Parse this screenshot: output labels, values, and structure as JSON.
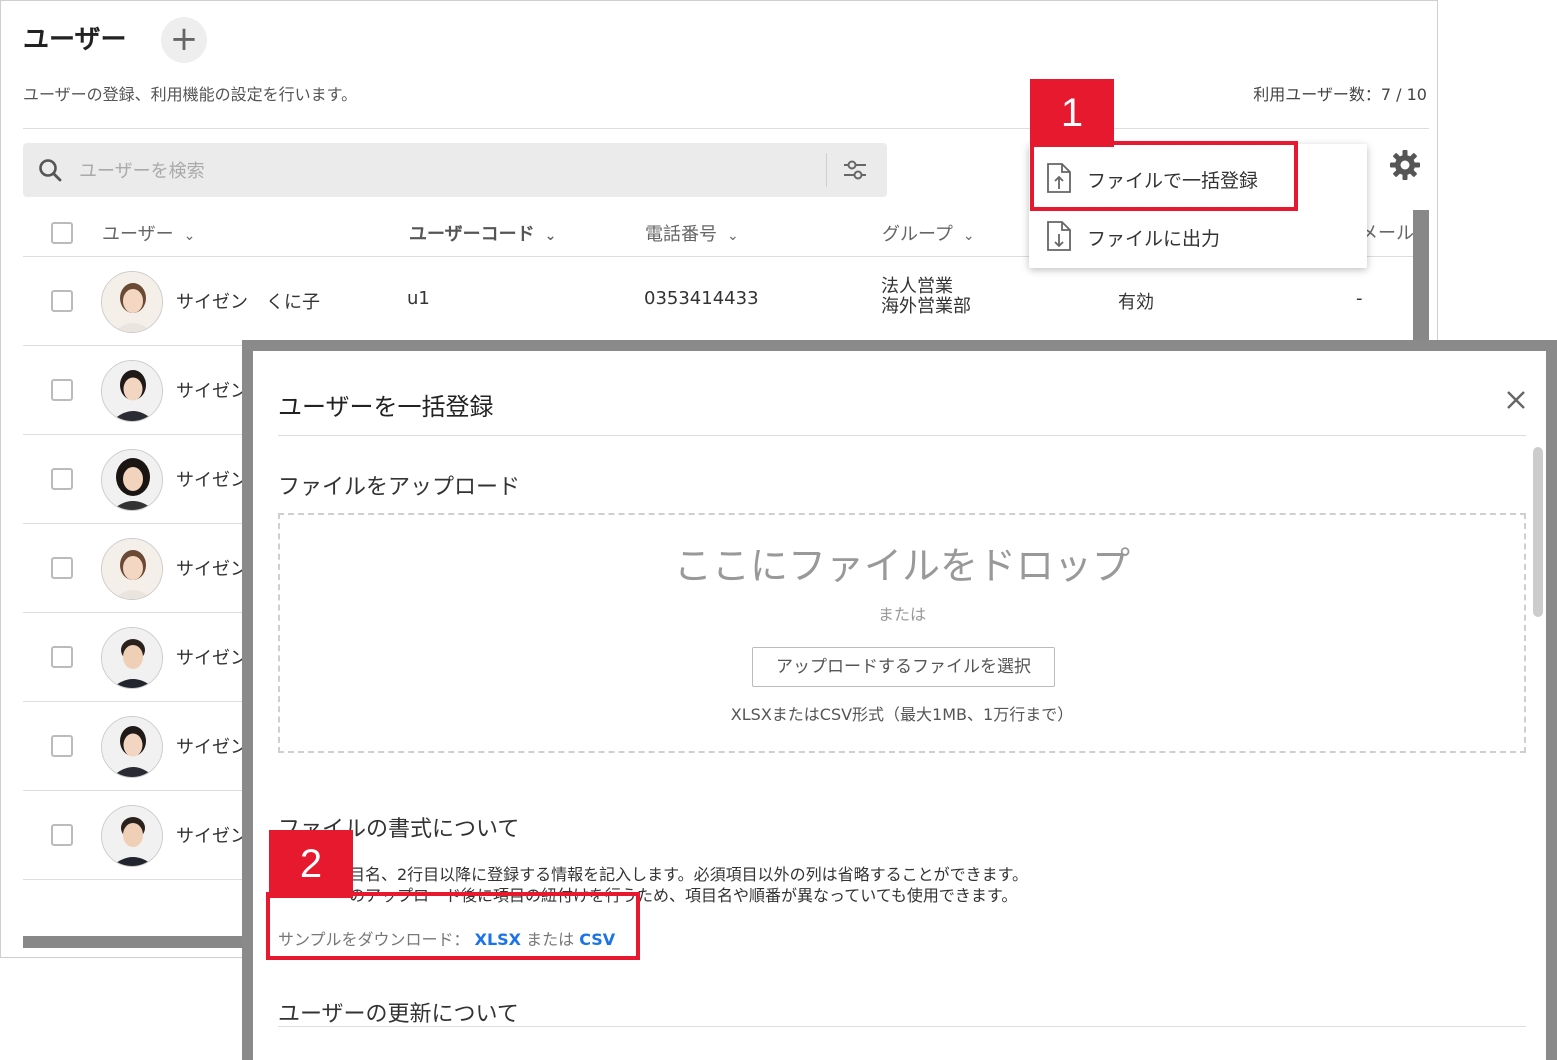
{
  "page": {
    "title": "ユーザー",
    "add_symbol": "+",
    "description": "ユーザーの登録、利用機能の設定を行います。",
    "user_count": "利用ユーザー数：7 / 10"
  },
  "search": {
    "placeholder": "ユーザーを検索"
  },
  "table": {
    "columns": [
      "ユーザー",
      "ユーザーコード",
      "電話番号",
      "グループ"
    ],
    "mail_column_partial": "メール",
    "first_row": {
      "name": "サイゼン　くに子",
      "code": "u1",
      "phone": "0353414433",
      "group_line1": "法人営業",
      "group_line2": "海外営業部",
      "status": "有効",
      "mail": "-"
    },
    "other_rows": [
      "サイゼン",
      "サイゼン",
      "サイゼン",
      "サイゼン",
      "サイゼン",
      "サイゼン"
    ]
  },
  "menu": {
    "items": [
      "ファイルで一括登録",
      "ファイルに出力"
    ]
  },
  "annotations": {
    "step1": "1",
    "step2": "2"
  },
  "modal": {
    "title": "ユーザーを一括登録",
    "upload_heading": "ファイルをアップロード",
    "drop_title": "ここにファイルをドロップ",
    "drop_or": "または",
    "select_button": "アップロードするファイルを選択",
    "drop_hint": "XLSXまたはCSV形式（最大1MB、1万行まで）",
    "format_heading": "ファイルの書式について",
    "format_line1": "目名、2行目以降に登録する情報を記入します。必須項目以外の列は省略することができます。",
    "format_line2": "のアップロード後に項目の紐付けを行うため、項目名や順番が異なっていても使用できます。",
    "sample_label": "サンプルをダウンロード：",
    "sample_xlsx": "XLSX",
    "sample_or": "または",
    "sample_csv": "CSV",
    "update_heading": "ユーザーの更新について"
  },
  "colors": {
    "accent_red": "#e6192e",
    "link_blue": "#1a73e8"
  }
}
